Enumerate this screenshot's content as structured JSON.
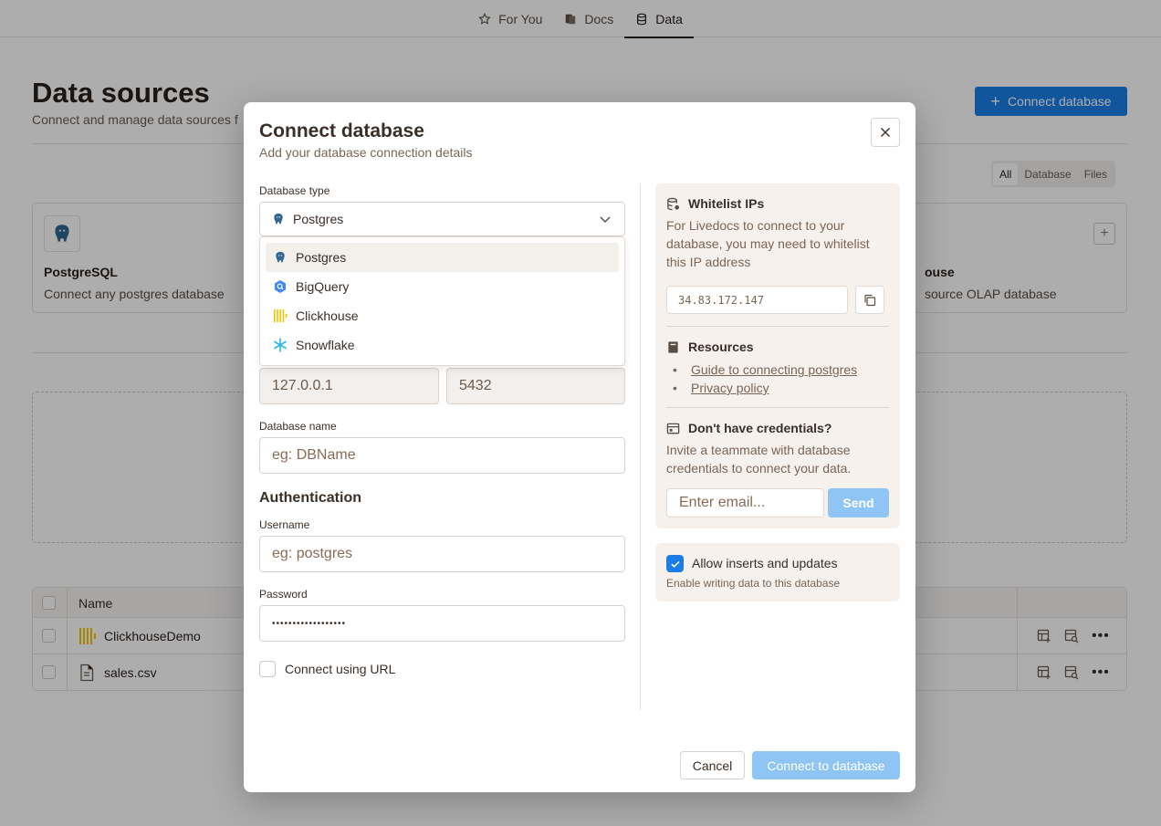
{
  "nav": {
    "tabs": [
      {
        "label": "For You",
        "icon": "star-user-icon"
      },
      {
        "label": "Docs",
        "icon": "docs-icon"
      },
      {
        "label": "Data",
        "icon": "database-icon"
      }
    ],
    "active": "Data"
  },
  "page": {
    "title": "Data sources",
    "subtitle": "Connect and manage data sources f",
    "connect_button": "Connect database",
    "filters": [
      "All",
      "Database",
      "Files"
    ],
    "active_filter": "All"
  },
  "cards": [
    {
      "title": "PostgreSQL",
      "description": "Connect any postgres database"
    },
    {
      "title": "ouse",
      "description": "source OLAP database"
    }
  ],
  "table": {
    "header_name": "Name",
    "rows": [
      {
        "name": "ClickhouseDemo",
        "icon": "clickhouse-icon"
      },
      {
        "name": "sales.csv",
        "icon": "file-icon"
      }
    ]
  },
  "modal": {
    "title": "Connect database",
    "subtitle": "Add your database connection details",
    "db_type_label": "Database type",
    "db_type_value": "Postgres",
    "dropdown_options": [
      "Postgres",
      "BigQuery",
      "Clickhouse",
      "Snowflake"
    ],
    "host_value": "127.0.0.1",
    "port_value": "5432",
    "db_name_label": "Database name",
    "db_name_placeholder": "eg: DBName",
    "auth_heading": "Authentication",
    "username_label": "Username",
    "username_placeholder": "eg: postgres",
    "password_label": "Password",
    "password_dots": "••••••••••••••••••",
    "url_label": "Connect using URL",
    "cancel": "Cancel",
    "submit": "Connect to database"
  },
  "whitelist": {
    "title": "Whitelist IPs",
    "line1": "For Livedocs to connect to your",
    "line2": "database, you may need to whitelist",
    "line3": "this IP address",
    "ip": "34.83.172.147"
  },
  "resources": {
    "title": "Resources",
    "links": [
      "Guide to connecting postgres",
      "Privacy policy"
    ]
  },
  "credentials": {
    "title": "Don't have credentials?",
    "line1": "Invite a teammate with database",
    "line2": "credentials to connect your data.",
    "email_placeholder": "Enter email...",
    "send": "Send"
  },
  "permissions": {
    "label": "Allow inserts and updates",
    "sub": "Enable writing data to this database",
    "checked": true
  },
  "colors": {
    "accent": "#1a7ee6",
    "accent_disabled": "#8fc5f5",
    "panel_bg": "#f6f1ed"
  }
}
